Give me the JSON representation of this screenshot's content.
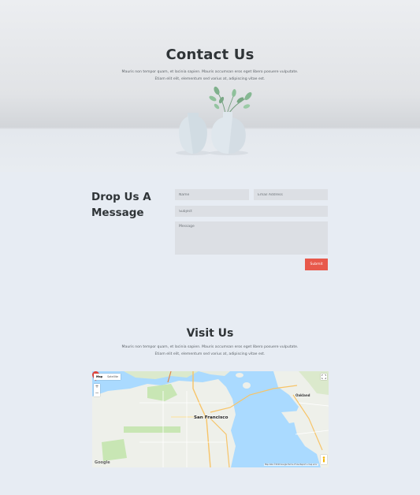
{
  "hero": {
    "title": "Contact Us",
    "subtitle": "Mauris non tempor quam, et lacinia sapien. Mauris accumsan eros eget libero posuere vulputate. Etiam elit elit, elementum sed varius at, adipiscing vitae est."
  },
  "form": {
    "heading": "Drop Us A Message",
    "name_placeholder": "Name",
    "email_placeholder": "Email Address",
    "subject_placeholder": "Subject",
    "message_placeholder": "Message",
    "submit_label": "Submit"
  },
  "visit": {
    "title": "Visit Us",
    "subtitle": "Mauris non tempor quam, et lacinia sapien. Mauris accumsan eros eget libero posuere vulputate. Etiam elit elit, elementum sed varius at, adipiscing vitae est."
  },
  "map": {
    "type_map": "Map",
    "type_satellite": "Satellite",
    "zoom_in": "+",
    "zoom_out": "−",
    "city": "San Francisco",
    "nearby_city": "Oakland",
    "logo": "Google",
    "footer": "Map data ©2019 Google   Terms of Use   Report a map error"
  }
}
